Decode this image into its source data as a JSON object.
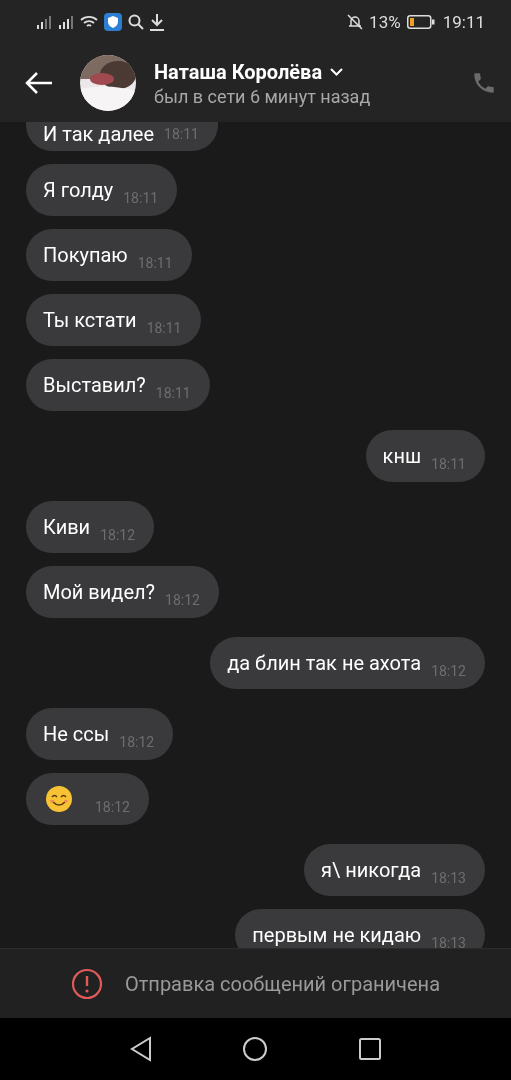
{
  "status_bar": {
    "battery": "13%",
    "time": "19:11"
  },
  "header": {
    "name": "Наташа Королёва",
    "status": "был в сети 6 минут назад"
  },
  "messages": [
    {
      "outgoing": false,
      "kind": "text",
      "text": "И так далее",
      "time": "18:11"
    },
    {
      "outgoing": false,
      "kind": "text",
      "text": "Я голду",
      "time": "18:11"
    },
    {
      "outgoing": false,
      "kind": "text",
      "text": "Покупаю",
      "time": "18:11"
    },
    {
      "outgoing": false,
      "kind": "text",
      "text": "Ты кстати",
      "time": "18:11"
    },
    {
      "outgoing": false,
      "kind": "text",
      "text": "Выставил?",
      "time": "18:11"
    },
    {
      "outgoing": true,
      "kind": "text",
      "text": "кнш",
      "time": "18:11"
    },
    {
      "outgoing": false,
      "kind": "text",
      "text": "Киви",
      "time": "18:12"
    },
    {
      "outgoing": false,
      "kind": "text",
      "text": "Мой видел?",
      "time": "18:12"
    },
    {
      "outgoing": true,
      "kind": "text",
      "text": "да блин так не ахота",
      "time": "18:12"
    },
    {
      "outgoing": false,
      "kind": "text",
      "text": "Не ссы",
      "time": "18:12"
    },
    {
      "outgoing": false,
      "kind": "emoji",
      "time": "18:12"
    },
    {
      "outgoing": true,
      "kind": "text",
      "text": "я\\ никогда",
      "time": "18:13"
    },
    {
      "outgoing": true,
      "kind": "text",
      "text": "первым не кидаю",
      "time": "18:13"
    }
  ],
  "notice": {
    "text": "Отправка сообщений ограничена"
  }
}
